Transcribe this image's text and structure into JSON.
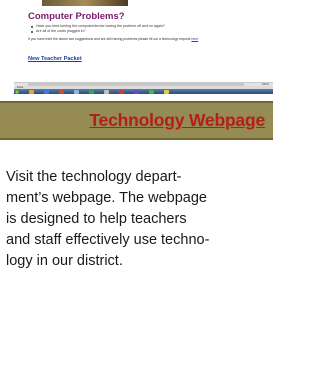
{
  "screenshot": {
    "heading": "Computer Problems?",
    "bullets": [
      "Have you tried turning the computer/device having the problem off and on again?",
      "Are all of the cords plugged in?"
    ],
    "note_text": "If you have tried the above two suggestions and are still having problems please fill out a technology request",
    "note_link": "here",
    "packet_link": "New Teacher Packet",
    "zoom": "100%",
    "status": "Done"
  },
  "banner": {
    "title": "Technology Webpage",
    "background": "#958b53",
    "title_color": "#b31d1d"
  },
  "body": {
    "text": "Visit the technology depart-\nment’s webpage. The webpage\nis designed to help teachers\nand staff effectively use techno-\nlogy in our district."
  }
}
